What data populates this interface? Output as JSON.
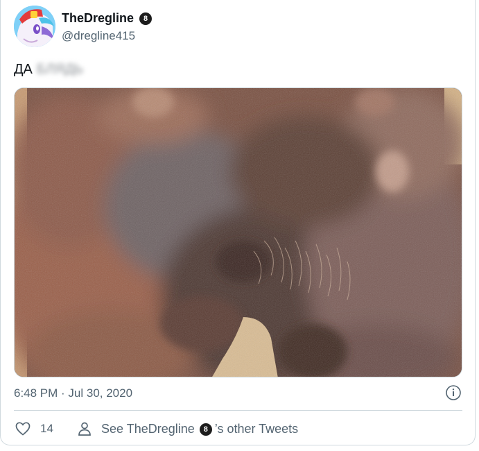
{
  "tweet": {
    "display_name": "TheDregline",
    "handle": "@dregline415",
    "badge_glyph": "8",
    "text_visible": "ДА",
    "text_blurred": "БЛЯДЬ",
    "timestamp": "6:48 PM · Jul 30, 2020",
    "like_count": "14",
    "other_tweets_prefix": "See TheDregline",
    "other_tweets_suffix": "’s other Tweets"
  },
  "colors": {
    "text_primary": "#0f1419",
    "text_secondary": "#536471",
    "border": "#cfd9de",
    "badge_bg": "#1d1d1d"
  },
  "icons": {
    "avatar": "pony-avatar",
    "badge": "eight-ball-icon",
    "info": "info-icon",
    "like": "heart-icon",
    "profile": "person-icon"
  }
}
